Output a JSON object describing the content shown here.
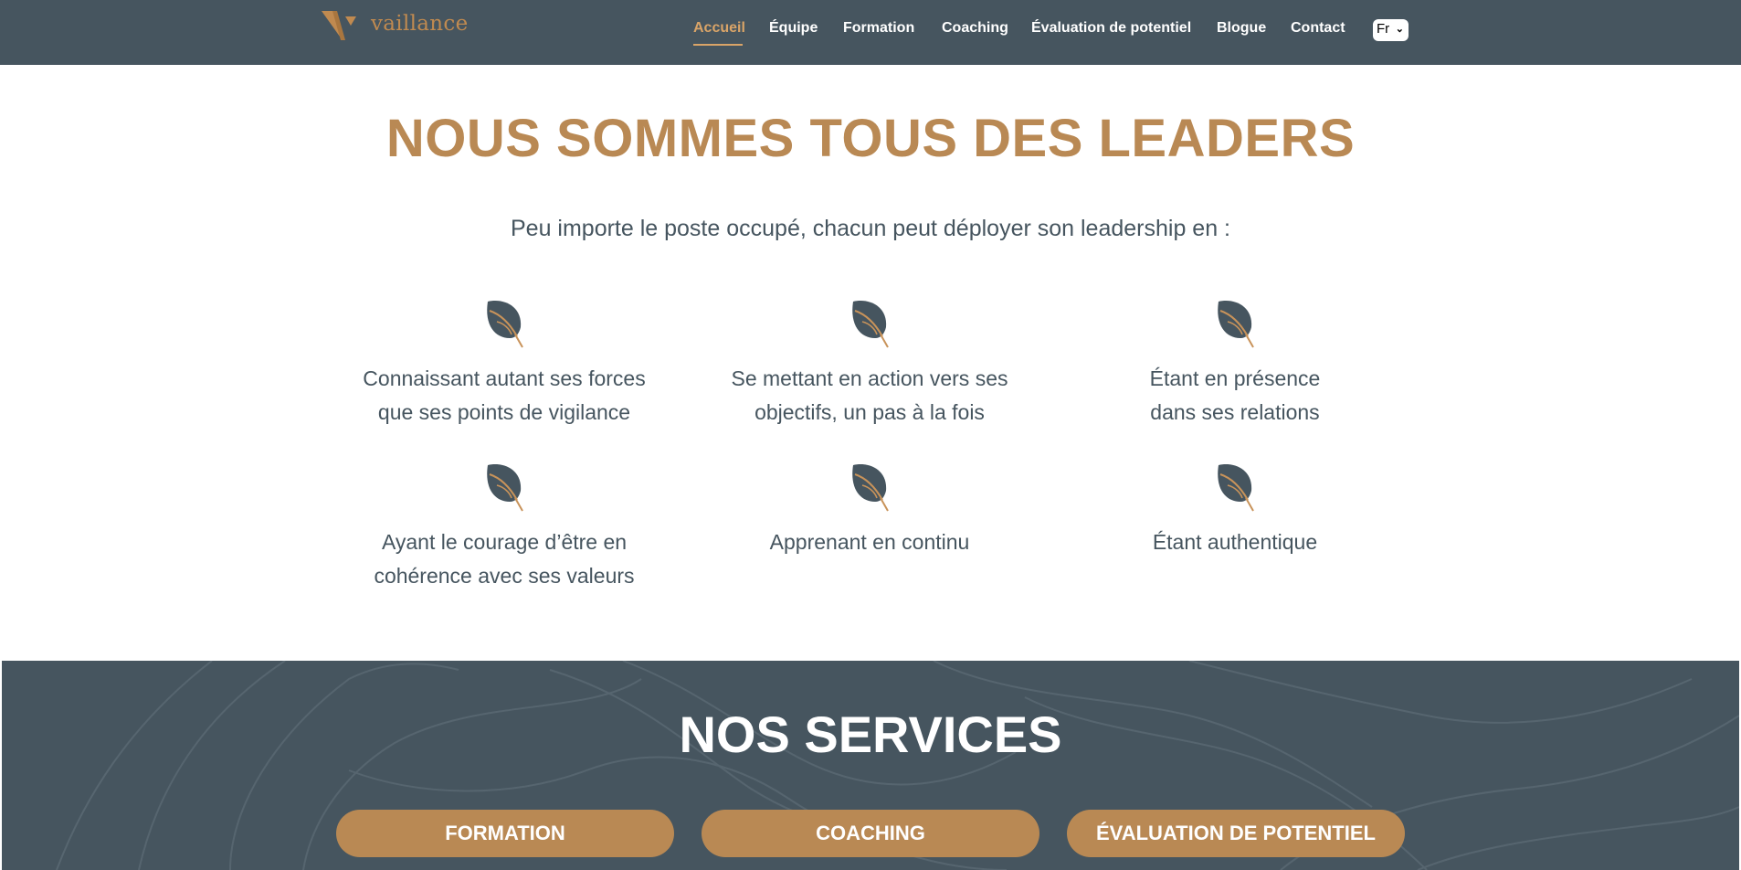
{
  "header": {
    "logo_text": "vaillance",
    "nav": [
      {
        "label": "Accueil"
      },
      {
        "label": "Équipe"
      },
      {
        "label": "Formation"
      },
      {
        "label": "Coaching"
      },
      {
        "label": "Évaluation de potentiel"
      },
      {
        "label": "Blogue"
      },
      {
        "label": "Contact"
      }
    ],
    "language": "Fr",
    "colors": {
      "bar": "#46555f",
      "accent": "#d9a468"
    }
  },
  "leaders": {
    "title": "NOUS SOMMES TOUS DES LEADERS",
    "subtitle": "Peu importe le poste occupé, chacun peut déployer son leadership en :",
    "icon": "leaf-icon",
    "items": [
      {
        "line1": "Connaissant autant ses forces",
        "line2": "que ses points de vigilance"
      },
      {
        "line1": "Se mettant en action vers ses",
        "line2": "objectifs, un pas à la fois"
      },
      {
        "line1": "Étant en présence",
        "line2": "dans ses relations"
      },
      {
        "line1": "Ayant le courage d’être en",
        "line2": "cohérence avec ses valeurs"
      },
      {
        "line1": "Apprenant en continu",
        "line2": ""
      },
      {
        "line1": "Étant authentique",
        "line2": ""
      }
    ]
  },
  "services": {
    "title": "NOS SERVICES",
    "buttons": [
      {
        "label": "FORMATION"
      },
      {
        "label": "COACHING"
      },
      {
        "label": "ÉVALUATION DE POTENTIEL"
      }
    ],
    "colors": {
      "background": "#46555f",
      "button": "#b98954"
    }
  }
}
